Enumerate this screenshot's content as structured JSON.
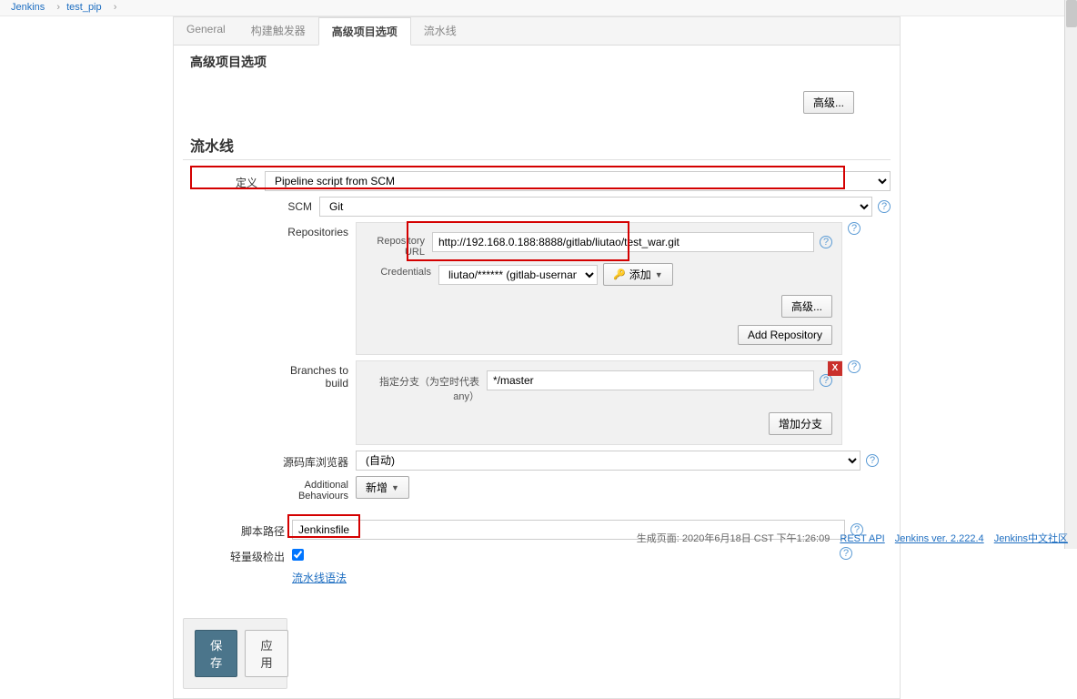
{
  "breadcrumb": {
    "root": "Jenkins",
    "project": "test_pip"
  },
  "tabs": {
    "general": "General",
    "triggers": "构建触发器",
    "advanced": "高级项目选项",
    "pipeline": "流水线"
  },
  "section_advanced_title": "高级项目选项",
  "advanced_btn": "高级...",
  "pipeline_section_title": "流水线",
  "definition": {
    "label": "定义",
    "value": "Pipeline script from SCM"
  },
  "scm": {
    "label": "SCM",
    "value": "Git"
  },
  "repositories": {
    "label": "Repositories",
    "repo_url_label": "Repository URL",
    "repo_url_value": "http://192.168.0.188:8888/gitlab/liutao/test_war.git",
    "credentials_label": "Credentials",
    "credentials_value": "liutao/****** (gitlab-username-name)",
    "add_btn": "添加",
    "advanced_btn": "高级...",
    "add_repo_btn": "Add Repository"
  },
  "branches": {
    "label": "Branches to build",
    "spec_label": "指定分支（为空时代表any）",
    "spec_value": "*/master",
    "delete_x": "X",
    "add_branch_btn": "增加分支"
  },
  "source_browser": {
    "label": "源码库浏览器",
    "value": "(自动)"
  },
  "additional_behaviours": {
    "label": "Additional Behaviours",
    "add_btn": "新增"
  },
  "script_path": {
    "label": "脚本路径",
    "value": "Jenkinsfile"
  },
  "lightweight": {
    "label": "轻量级检出"
  },
  "pipeline_syntax_link": "流水线语法",
  "save_btn": "保存",
  "apply_btn": "应用",
  "footer": {
    "gen_text": "生成页面: 2020年6月18日 CST 下午1:26:09",
    "rest_api": "REST API",
    "version": "Jenkins ver. 2.222.4",
    "community": "Jenkins中文社区"
  }
}
